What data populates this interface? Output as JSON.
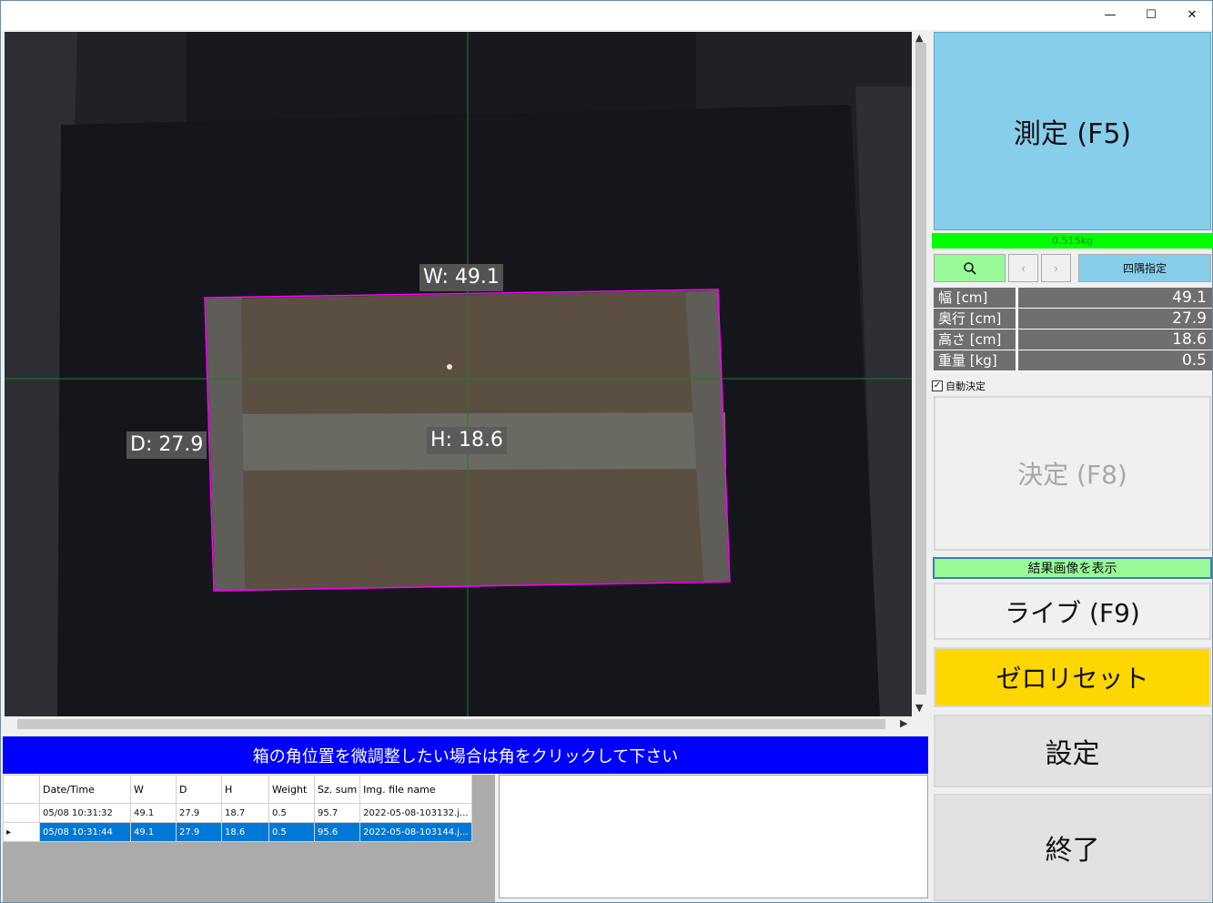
{
  "window": {
    "minimize_glyph": "—",
    "maximize_glyph": "☐",
    "close_glyph": "✕"
  },
  "image": {
    "label_w": "W: 49.1",
    "label_d": "D: 27.9",
    "label_h": "H: 18.6"
  },
  "instruction": "箱の角位置を微調整したい場合は角をクリックして下さい",
  "table": {
    "columns": [
      "Date/Time",
      "W",
      "D",
      "H",
      "Weight",
      "Sz. sum",
      "Img. file name"
    ],
    "rows": [
      [
        "05/08 10:31:32",
        "49.1",
        "27.9",
        "18.7",
        "0.5",
        "95.7",
        "2022-05-08-103132.j..."
      ],
      [
        "05/08 10:31:44",
        "49.1",
        "27.9",
        "18.6",
        "0.5",
        "95.6",
        "2022-05-08-103144.j..."
      ]
    ]
  },
  "panel": {
    "measure_label": "測定 (F5)",
    "weight_readout": "0.515kg",
    "corner_label": "四隅指定",
    "values": [
      {
        "key": "幅 [cm]",
        "value": "49.1"
      },
      {
        "key": "奥行 [cm]",
        "value": "27.9"
      },
      {
        "key": "高さ [cm]",
        "value": "18.6"
      },
      {
        "key": "重量 [kg]",
        "value": "0.5"
      }
    ],
    "auto_label": "自動決定",
    "decide_label": "決定 (F8)",
    "show_result_label": "結果画像を表示",
    "live_label": "ライブ (F9)",
    "zero_reset_label": "ゼロリセット",
    "settings_label": "設定",
    "quit_label": "終了"
  },
  "colors": {
    "measure_bg": "#87ceeb",
    "weight_bar": "#00ff00",
    "zero_bg": "#ffd700",
    "instruction_bg": "#0000ff",
    "selection": "#0078d7",
    "box_outline": "#ff00ff"
  }
}
